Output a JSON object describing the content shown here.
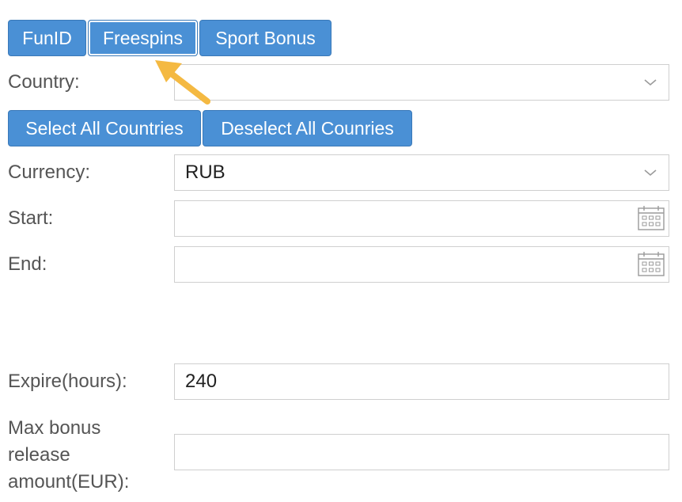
{
  "tabs": [
    {
      "label": "FunID"
    },
    {
      "label": "Freespins"
    },
    {
      "label": "Sport Bonus"
    }
  ],
  "country": {
    "label": "Country:",
    "value": ""
  },
  "country_actions": {
    "select_all": "Select All Countries",
    "deselect_all": "Deselect All Counries"
  },
  "currency": {
    "label": "Currency:",
    "value": "RUB"
  },
  "start": {
    "label": "Start:",
    "value": ""
  },
  "end": {
    "label": "End:",
    "value": ""
  },
  "expire": {
    "label": "Expire(hours):",
    "value": "240"
  },
  "max_bonus": {
    "label_lines": [
      "Max bonus",
      "release",
      "amount(EUR):"
    ],
    "value": ""
  },
  "colors": {
    "button": "#4a90d5",
    "arrow": "#f4b942"
  },
  "icons": [
    "chevron-down-icon",
    "calendar-icon",
    "pointer-arrow-icon"
  ]
}
